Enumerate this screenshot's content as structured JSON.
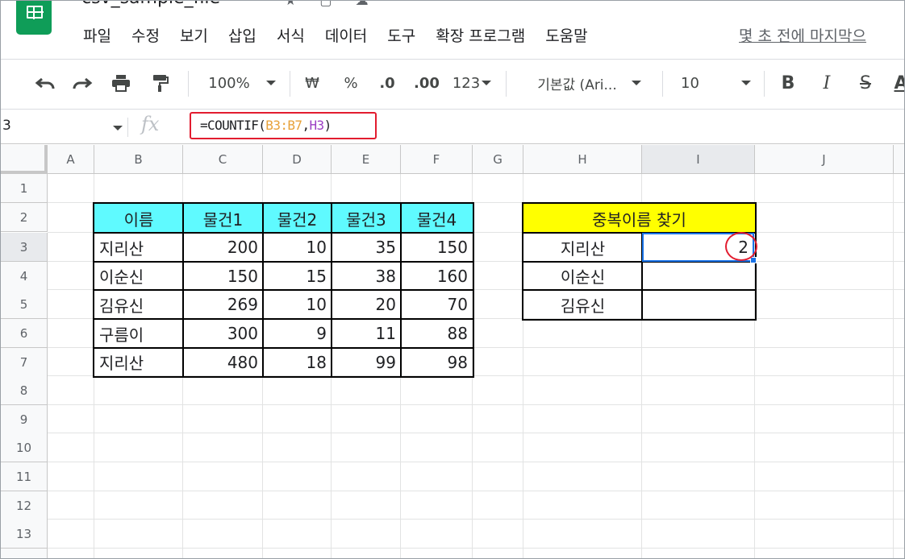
{
  "app": {
    "doc_title": "csv_sample_file",
    "menu": [
      "파일",
      "수정",
      "보기",
      "삽입",
      "서식",
      "데이터",
      "도구",
      "확장 프로그램",
      "도움말"
    ],
    "last_edit": "몇 초 전에 마지막으"
  },
  "toolbar": {
    "zoom": "100%",
    "currency": "₩",
    "percent": "%",
    "dec_decrease": ".0",
    "dec_increase": ".00",
    "more_formats": "123",
    "font": "기본값 (Ari...",
    "font_size": "10",
    "bold": "B",
    "italic": "I",
    "strike": "S",
    "text_color": "A"
  },
  "formula_bar": {
    "name_box": "3",
    "fx": "fx",
    "formula_prefix": "=COUNTIF(",
    "formula_range": "B3:B7",
    "formula_sep": ",",
    "formula_ref": "H3",
    "formula_suffix": ")"
  },
  "grid": {
    "columns": [
      "A",
      "B",
      "C",
      "D",
      "E",
      "F",
      "G",
      "H",
      "I",
      "J"
    ],
    "rows": [
      "1",
      "2",
      "3",
      "4",
      "5",
      "6",
      "7",
      "8",
      "9",
      "10",
      "11",
      "12",
      "13"
    ],
    "selected_column": "I",
    "selected_row": "3"
  },
  "main_table": {
    "headers": [
      "이름",
      "물건1",
      "물건2",
      "물건3",
      "물건4"
    ],
    "rows": [
      [
        "지리산",
        "200",
        "10",
        "35",
        "150"
      ],
      [
        "이순신",
        "150",
        "15",
        "38",
        "160"
      ],
      [
        "김유신",
        "269",
        "10",
        "20",
        "70"
      ],
      [
        "구름이",
        "300",
        "9",
        "11",
        "88"
      ],
      [
        "지리산",
        "480",
        "18",
        "99",
        "98"
      ]
    ],
    "header_color": "#5ffaff"
  },
  "dup_table": {
    "title": "중복이름 찾기",
    "names": [
      "지리산",
      "이순신",
      "김유신"
    ],
    "results": [
      "2",
      "",
      ""
    ],
    "title_color": "#ffff00"
  },
  "colors": {
    "selection": "#1a73e8",
    "highlight": "#e21c2f"
  }
}
